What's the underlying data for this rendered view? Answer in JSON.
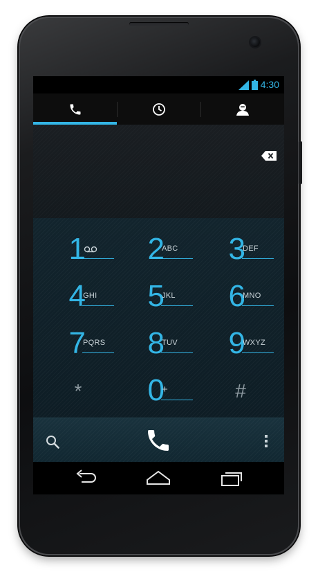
{
  "status": {
    "time": "4:30"
  },
  "tabs": [
    {
      "icon": "phone-icon",
      "selected": true
    },
    {
      "icon": "clock-icon",
      "selected": false
    },
    {
      "icon": "contacts-icon",
      "selected": false
    }
  ],
  "dialpad": {
    "keys": [
      {
        "digit": "1",
        "letters": "",
        "icon": "voicemail-icon"
      },
      {
        "digit": "2",
        "letters": "ABC"
      },
      {
        "digit": "3",
        "letters": "DEF"
      },
      {
        "digit": "4",
        "letters": "GHI"
      },
      {
        "digit": "5",
        "letters": "JKL"
      },
      {
        "digit": "6",
        "letters": "MNO"
      },
      {
        "digit": "7",
        "letters": "PQRS"
      },
      {
        "digit": "8",
        "letters": "TUV"
      },
      {
        "digit": "9",
        "letters": "WXYZ"
      },
      {
        "digit": "*",
        "letters": ""
      },
      {
        "digit": "0",
        "letters": "+"
      },
      {
        "digit": "#",
        "letters": ""
      }
    ]
  },
  "colors": {
    "accent": "#33b5e5",
    "keypad_bg": "#12242d",
    "statusbar_bg": "#000000"
  }
}
